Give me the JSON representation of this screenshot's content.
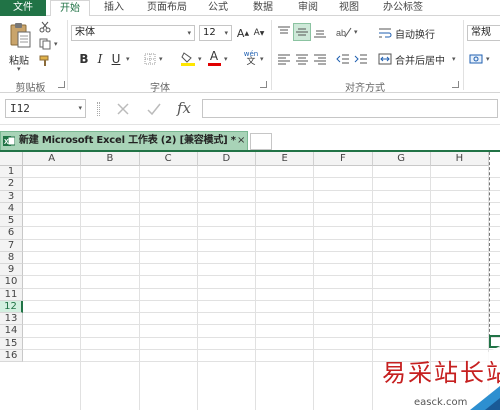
{
  "ribbon_tabs": [
    {
      "label": "文件"
    },
    {
      "label": "开始"
    },
    {
      "label": "插入"
    },
    {
      "label": "页面布局"
    },
    {
      "label": "公式"
    },
    {
      "label": "数据"
    },
    {
      "label": "审阅"
    },
    {
      "label": "视图"
    },
    {
      "label": "办公标签"
    }
  ],
  "clipboard": {
    "paste_label": "粘贴",
    "group_label": "剪贴板"
  },
  "font": {
    "name": "宋体",
    "size": "12",
    "group_label": "字体",
    "bold": "B",
    "italic": "I",
    "underline": "U",
    "grow": "A",
    "shrink": "A",
    "font_color": "A",
    "phonetic": "wén"
  },
  "alignment": {
    "wrap_text": "自动换行",
    "merge_center": "合并后居中",
    "group_label": "对齐方式"
  },
  "number": {
    "format": "常规"
  },
  "formula_bar": {
    "name_box": "I12",
    "fx": "fx",
    "formula": ""
  },
  "workbook_tab": {
    "title": "新建 Microsoft Excel 工作表 (2)  [兼容模式] *",
    "close": "×"
  },
  "grid": {
    "columns": [
      "A",
      "B",
      "C",
      "D",
      "E",
      "F",
      "G",
      "H"
    ],
    "rows": [
      "1",
      "2",
      "3",
      "4",
      "5",
      "6",
      "7",
      "8",
      "9",
      "10",
      "11",
      "12",
      "13",
      "14",
      "15",
      "16"
    ],
    "active_row": "12"
  },
  "watermark": {
    "text": "易采站长站",
    "url": "easck.com"
  },
  "colors": {
    "accent": "#217346",
    "tab_fill": "#a8d3b7",
    "watermark": "#c62020"
  }
}
